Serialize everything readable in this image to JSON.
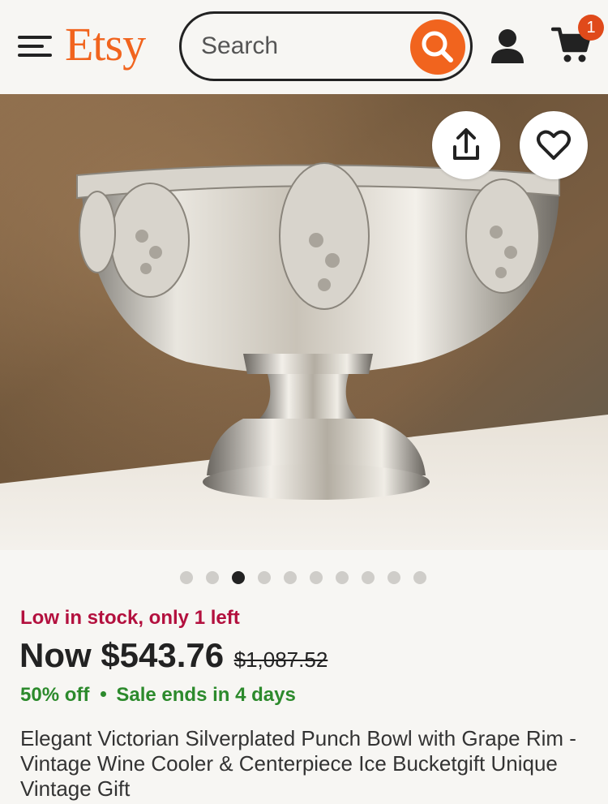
{
  "header": {
    "logo": "Etsy",
    "search_placeholder": "Search",
    "cart_count": "1"
  },
  "colors": {
    "brand": "#f1641e",
    "stock_warning": "#b3103e",
    "sale_green": "#2c8a2c",
    "dot_active": "#222222",
    "dot_inactive": "#cfcdc9"
  },
  "icons": {
    "menu": "menu-icon",
    "search": "search-icon",
    "account": "user-icon",
    "cart": "cart-icon",
    "share": "share-icon",
    "favorite": "heart-icon"
  },
  "carousel": {
    "total": 10,
    "active_index": 2
  },
  "product": {
    "stock_text": "Low in stock, only 1 left",
    "price_now": "Now $543.76",
    "price_original": "$1,087.52",
    "discount": "50% off",
    "sale_ends": "Sale ends in 4 days",
    "title": "Elegant Victorian Silverplated Punch Bowl with Grape Rim - Vintage Wine Cooler & Centerpiece Ice Bucketgift Unique Vintage Gift"
  }
}
